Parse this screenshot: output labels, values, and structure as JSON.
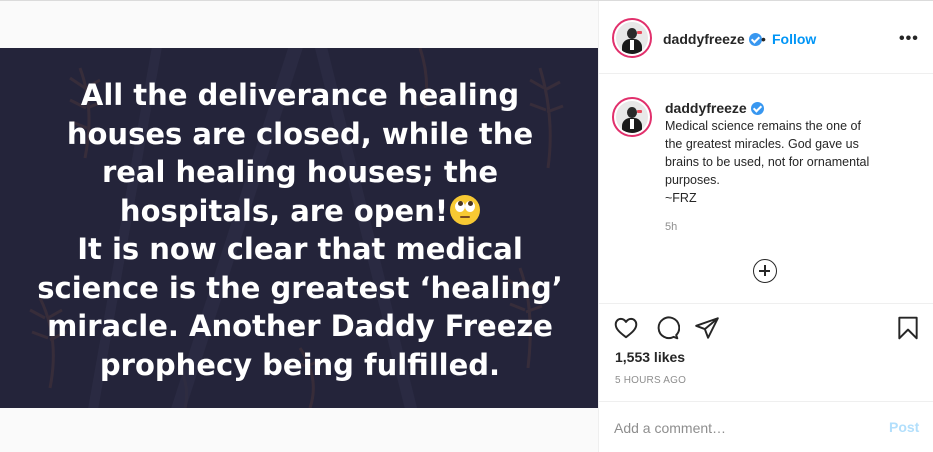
{
  "media": {
    "lines": [
      "All the deliverance healing",
      "houses are closed, while the",
      "real healing houses; the",
      "hospitals, are open!",
      "It is now clear that medical",
      "science is the greatest ‘healing’",
      "miracle. Another Daddy Freeze",
      "prophecy being fulfilled."
    ],
    "emoji": "face-with-rolling-eyes-icon",
    "background_color": "#24243a"
  },
  "header": {
    "username": "daddyfreeze",
    "separator": "•",
    "follow_label": "Follow",
    "more_label": "•••"
  },
  "caption": {
    "username": "daddyfreeze",
    "lines": [
      "Medical science remains the one of",
      "the greatest miracles. God gave us",
      "brains to be used, not for ornamental",
      "purposes.",
      "~FRZ"
    ],
    "time": "5h"
  },
  "actions": {
    "icons": [
      "heart-icon",
      "comment-icon",
      "share-icon",
      "bookmark-icon"
    ]
  },
  "likes": "1,553 likes",
  "posted_ago": "5 HOURS AGO",
  "comment": {
    "placeholder": "Add a comment…",
    "post_label": "Post"
  },
  "colors": {
    "link": "#0095f6",
    "verified": "#3897f0",
    "post_disabled": "#b2dffc"
  }
}
